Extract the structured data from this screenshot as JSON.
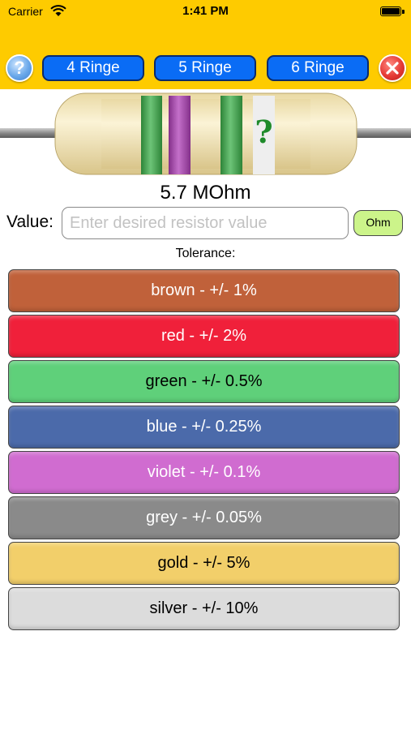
{
  "status_bar": {
    "carrier": "Carrier",
    "time": "1:41 PM"
  },
  "toolbar": {
    "help_label": "?",
    "rings": [
      "4 Ringe",
      "5 Ringe",
      "6 Ringe"
    ],
    "help_icon": "question-circle-icon",
    "close_icon": "close-circle-icon"
  },
  "resistor": {
    "bands": [
      {
        "color": "green",
        "hex": "#3cb04a"
      },
      {
        "color": "violet",
        "hex": "#b040b8"
      },
      {
        "color": "green",
        "hex": "#3cb04a"
      }
    ],
    "unknown_band_symbol": "?",
    "display_value": "5.7 MOhm"
  },
  "value_entry": {
    "label": "Value:",
    "placeholder": "Enter desired resistor value",
    "unit_button": "Ohm"
  },
  "tolerance": {
    "label": "Tolerance:",
    "options": [
      {
        "text": "brown - +/- 1%",
        "bg": "#c0613a",
        "fg": "#ffffff"
      },
      {
        "text": "red - +/- 2%",
        "bg": "#f0203a",
        "fg": "#ffffff"
      },
      {
        "text": "green - +/- 0.5%",
        "bg": "#5fd07a",
        "fg": "#000000"
      },
      {
        "text": "blue - +/- 0.25%",
        "bg": "#4b6aaa",
        "fg": "#ffffff"
      },
      {
        "text": "violet - +/- 0.1%",
        "bg": "#d06cd0",
        "fg": "#ffffff"
      },
      {
        "text": "grey - +/- 0.05%",
        "bg": "#8a8a8a",
        "fg": "#ffffff"
      },
      {
        "text": "gold - +/- 5%",
        "bg": "#f2cf6a",
        "fg": "#000000"
      },
      {
        "text": "silver - +/- 10%",
        "bg": "#dcdcdc",
        "fg": "#000000"
      }
    ]
  }
}
